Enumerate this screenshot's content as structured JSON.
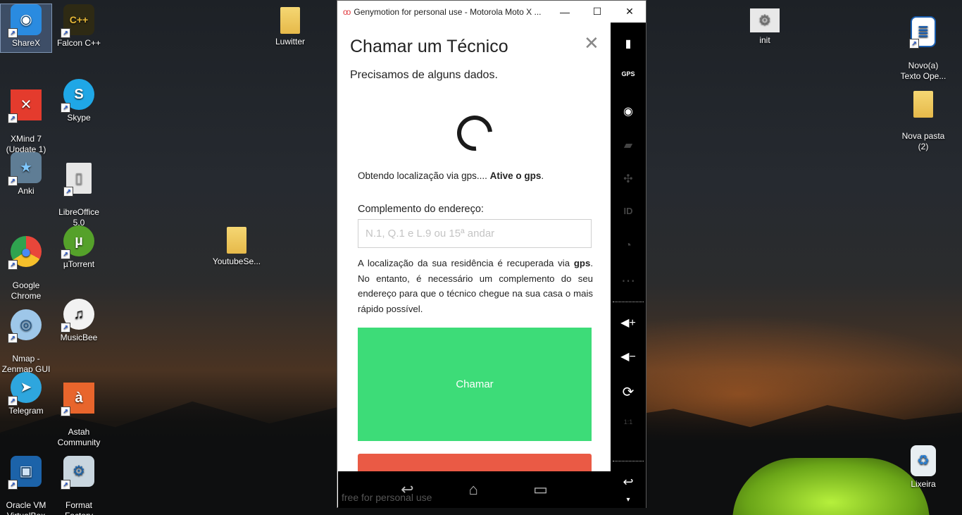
{
  "desktop": {
    "icons": [
      {
        "id": "sharex",
        "label": "ShareX",
        "glyph": "◉",
        "color": "#2a8be0"
      },
      {
        "id": "falcon",
        "label": "Falcon C++",
        "glyph": "C++",
        "color": "#2e2a14"
      },
      {
        "id": "luwitter",
        "label": "Luwitter"
      },
      {
        "id": "init",
        "label": "init",
        "glyph": "⚙",
        "color": "#e8e8e8"
      },
      {
        "id": "novo-texto",
        "label": "Novo(a)\nTexto Ope...",
        "glyph": "≣",
        "color": "#1b5fb0"
      },
      {
        "id": "xmind",
        "label": "XMind 7\n(Update 1)",
        "glyph": "✕",
        "color": "#e43b2d"
      },
      {
        "id": "skype",
        "label": "Skype",
        "glyph": "S",
        "color": "#1fa7e6"
      },
      {
        "id": "nova-pasta",
        "label": "Nova pasta\n(2)"
      },
      {
        "id": "anki",
        "label": "Anki",
        "glyph": "★",
        "color": "#5f7d95"
      },
      {
        "id": "libreoffice",
        "label": "LibreOffice\n5.0",
        "glyph": "▯",
        "color": "#e6e6e6"
      },
      {
        "id": "chrome",
        "label": "Google\nChrome",
        "glyph": "●",
        "color": "#e9463a"
      },
      {
        "id": "utorrent",
        "label": "µTorrent",
        "glyph": "µ",
        "color": "#55a12a"
      },
      {
        "id": "youtubese",
        "label": "YoutubeSe..."
      },
      {
        "id": "nmap",
        "label": "Nmap -\nZenmap GUI",
        "glyph": "◎",
        "color": "#9ec7e9"
      },
      {
        "id": "musicbee",
        "label": "MusicBee",
        "glyph": "♫",
        "color": "#f2f2f2"
      },
      {
        "id": "telegram",
        "label": "Telegram",
        "glyph": "➤",
        "color": "#2ea6de"
      },
      {
        "id": "astah",
        "label": "Astah\nCommunity",
        "glyph": "à",
        "color": "#e8652c"
      },
      {
        "id": "virtualbox",
        "label": "Oracle VM\nVirtualBox",
        "glyph": "▣",
        "color": "#1c63a9"
      },
      {
        "id": "format-factory",
        "label": "Format\nFactory",
        "glyph": "⚙",
        "color": "#c9d6df"
      },
      {
        "id": "lixeira",
        "label": "Lixeira",
        "glyph": "♻",
        "color": "#e8eef2"
      }
    ]
  },
  "window": {
    "logo": "oo",
    "title": "Genymotion for personal use - Motorola Moto X ...",
    "minimize": "—",
    "maximize": "☐",
    "close": "✕"
  },
  "app": {
    "title": "Chamar um Técnico",
    "close": "✕",
    "subtitle": "Precisamos de alguns dados.",
    "gps_status_prefix": "Obtendo localização via gps.... ",
    "gps_status_action": "Ative o gps",
    "gps_status_suffix": ".",
    "complement_label": "Complemento do endereço:",
    "complement_value": "",
    "complement_placeholder": "N.1, Q.1 e L.9 ou 15ª andar",
    "info_part1": "A localização da sua residência é recuperada via ",
    "info_bold": "gps",
    "info_part2": ". No entanto, é necessário um complemento do seu endereço para que o técnico chegue na sua casa o mais rápido possível.",
    "call_button": "Chamar",
    "cancel_button": ""
  },
  "navbar": {
    "back": "↩",
    "home": "⌂",
    "recents": "▭"
  },
  "watermark": "free for personal use",
  "sidebar": {
    "battery": "▮",
    "gps": "GPS",
    "camera": "◉",
    "capture": "▰",
    "dpad": "✣",
    "id": "ID",
    "rss": "◔",
    "sms": "⋯",
    "vol_up": "◀+",
    "vol_down": "◀−",
    "rotate": "⟳",
    "pixel": "1:1",
    "back": "↩",
    "more": "▾"
  },
  "colors": {
    "call_button": "#3ddc78",
    "cancel_button": "#ea5a45",
    "folder": "#f0cc63"
  }
}
